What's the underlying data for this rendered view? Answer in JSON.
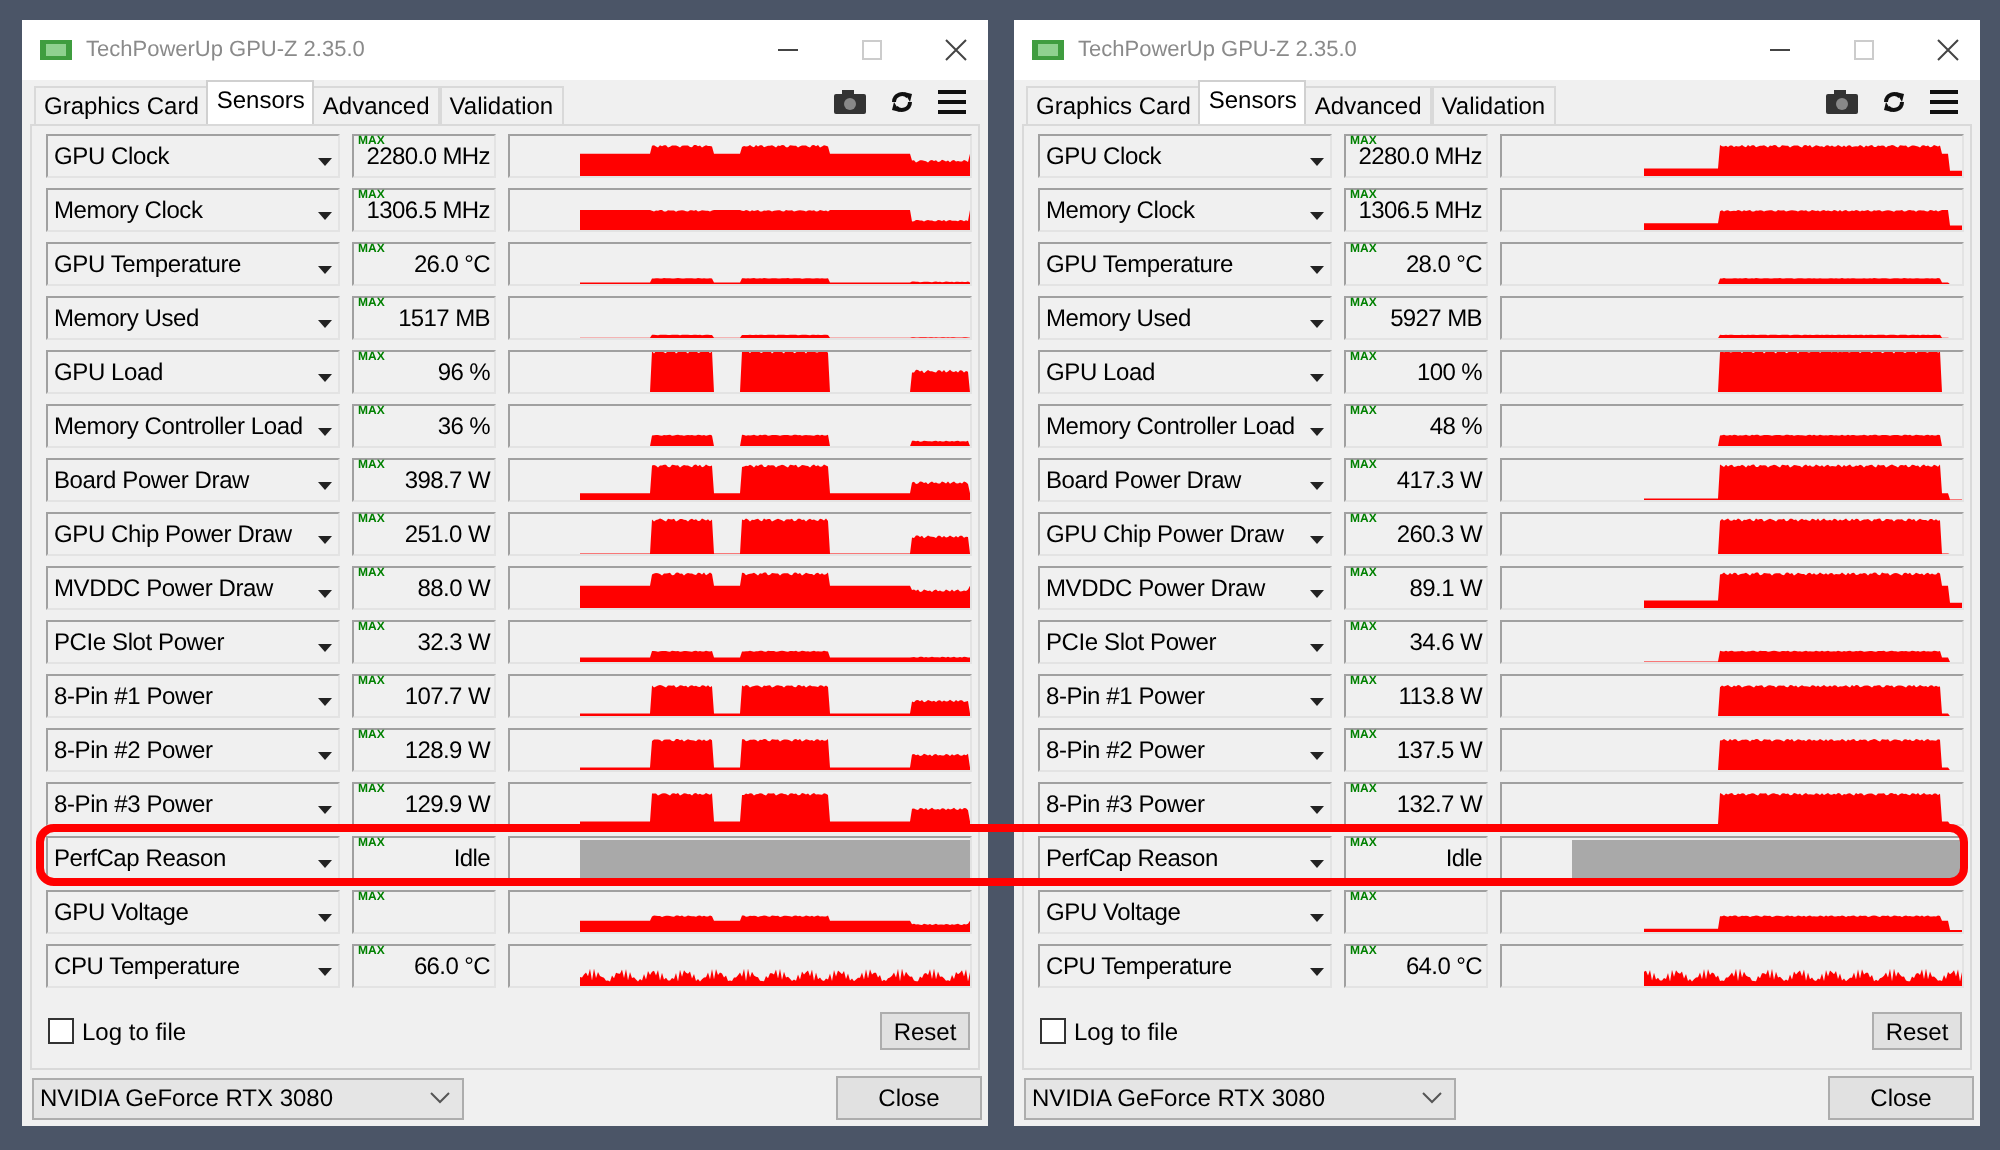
{
  "windows": [
    {
      "title": "TechPowerUp GPU-Z 2.35.0",
      "tabs": [
        {
          "label": "Graphics Card",
          "selected": false
        },
        {
          "label": "Sensors",
          "selected": true
        },
        {
          "label": "Advanced",
          "selected": false
        },
        {
          "label": "Validation",
          "selected": false
        }
      ],
      "sensors": [
        {
          "name": "GPU Clock",
          "max_label": "MAX",
          "value": "2280.0 MHz",
          "kind": "sensor"
        },
        {
          "name": "Memory Clock",
          "max_label": "MAX",
          "value": "1306.5 MHz",
          "kind": "sensor"
        },
        {
          "name": "GPU Temperature",
          "max_label": "MAX",
          "value": "26.0 °C",
          "kind": "sensor"
        },
        {
          "name": "Memory Used",
          "max_label": "MAX",
          "value": "1517 MB",
          "kind": "sensor"
        },
        {
          "name": "GPU Load",
          "max_label": "MAX",
          "value": "96 %",
          "kind": "sensor"
        },
        {
          "name": "Memory Controller Load",
          "max_label": "MAX",
          "value": "36 %",
          "kind": "sensor"
        },
        {
          "name": "Board Power Draw",
          "max_label": "MAX",
          "value": "398.7 W",
          "kind": "sensor"
        },
        {
          "name": "GPU Chip Power Draw",
          "max_label": "MAX",
          "value": "251.0 W",
          "kind": "sensor"
        },
        {
          "name": "MVDDC Power Draw",
          "max_label": "MAX",
          "value": "88.0 W",
          "kind": "sensor"
        },
        {
          "name": "PCIe Slot Power",
          "max_label": "MAX",
          "value": "32.3 W",
          "kind": "sensor"
        },
        {
          "name": "8-Pin #1 Power",
          "max_label": "MAX",
          "value": "107.7 W",
          "kind": "sensor"
        },
        {
          "name": "8-Pin #2 Power",
          "max_label": "MAX",
          "value": "128.9 W",
          "kind": "sensor"
        },
        {
          "name": "8-Pin #3 Power",
          "max_label": "MAX",
          "value": "129.9 W",
          "kind": "sensor"
        },
        {
          "name": "PerfCap Reason",
          "max_label": "MAX",
          "value": "Idle",
          "kind": "status"
        },
        {
          "name": "GPU Voltage",
          "max_label": "MAX",
          "kind": "sensor"
        },
        {
          "name": "CPU Temperature",
          "max_label": "MAX",
          "value": "66.0 °C",
          "kind": "sensor"
        }
      ],
      "log_to_file": {
        "label": "Log to file",
        "checked": false
      },
      "reset_button": "Reset",
      "gpu_select": "NVIDIA GeForce RTX 3080",
      "close_button": "Close"
    },
    {
      "title": "TechPowerUp GPU-Z 2.35.0",
      "tabs": [
        {
          "label": "Graphics Card",
          "selected": false
        },
        {
          "label": "Sensors",
          "selected": true
        },
        {
          "label": "Advanced",
          "selected": false
        },
        {
          "label": "Validation",
          "selected": false
        }
      ],
      "sensors": [
        {
          "name": "GPU Clock",
          "max_label": "MAX",
          "value": "2280.0 MHz",
          "kind": "sensor"
        },
        {
          "name": "Memory Clock",
          "max_label": "MAX",
          "value": "1306.5 MHz",
          "kind": "sensor"
        },
        {
          "name": "GPU Temperature",
          "max_label": "MAX",
          "value": "28.0 °C",
          "kind": "sensor"
        },
        {
          "name": "Memory Used",
          "max_label": "MAX",
          "value": "5927 MB",
          "kind": "sensor"
        },
        {
          "name": "GPU Load",
          "max_label": "MAX",
          "value": "100 %",
          "kind": "sensor"
        },
        {
          "name": "Memory Controller Load",
          "max_label": "MAX",
          "value": "48 %",
          "kind": "sensor"
        },
        {
          "name": "Board Power Draw",
          "max_label": "MAX",
          "value": "417.3 W",
          "kind": "sensor"
        },
        {
          "name": "GPU Chip Power Draw",
          "max_label": "MAX",
          "value": "260.3 W",
          "kind": "sensor"
        },
        {
          "name": "MVDDC Power Draw",
          "max_label": "MAX",
          "value": "89.1 W",
          "kind": "sensor"
        },
        {
          "name": "PCIe Slot Power",
          "max_label": "MAX",
          "value": "34.6 W",
          "kind": "sensor"
        },
        {
          "name": "8-Pin #1 Power",
          "max_label": "MAX",
          "value": "113.8 W",
          "kind": "sensor"
        },
        {
          "name": "8-Pin #2 Power",
          "max_label": "MAX",
          "value": "137.5 W",
          "kind": "sensor"
        },
        {
          "name": "8-Pin #3 Power",
          "max_label": "MAX",
          "value": "132.7 W",
          "kind": "sensor"
        },
        {
          "name": "PerfCap Reason",
          "max_label": "MAX",
          "value": "Idle",
          "kind": "status"
        },
        {
          "name": "GPU Voltage",
          "max_label": "MAX",
          "kind": "sensor"
        },
        {
          "name": "CPU Temperature",
          "max_label": "MAX",
          "value": "64.0 °C",
          "kind": "sensor"
        }
      ],
      "log_to_file": {
        "label": "Log to file",
        "checked": false
      },
      "reset_button": "Reset",
      "gpu_select": "NVIDIA GeForce RTX 3080",
      "close_button": "Close"
    }
  ]
}
